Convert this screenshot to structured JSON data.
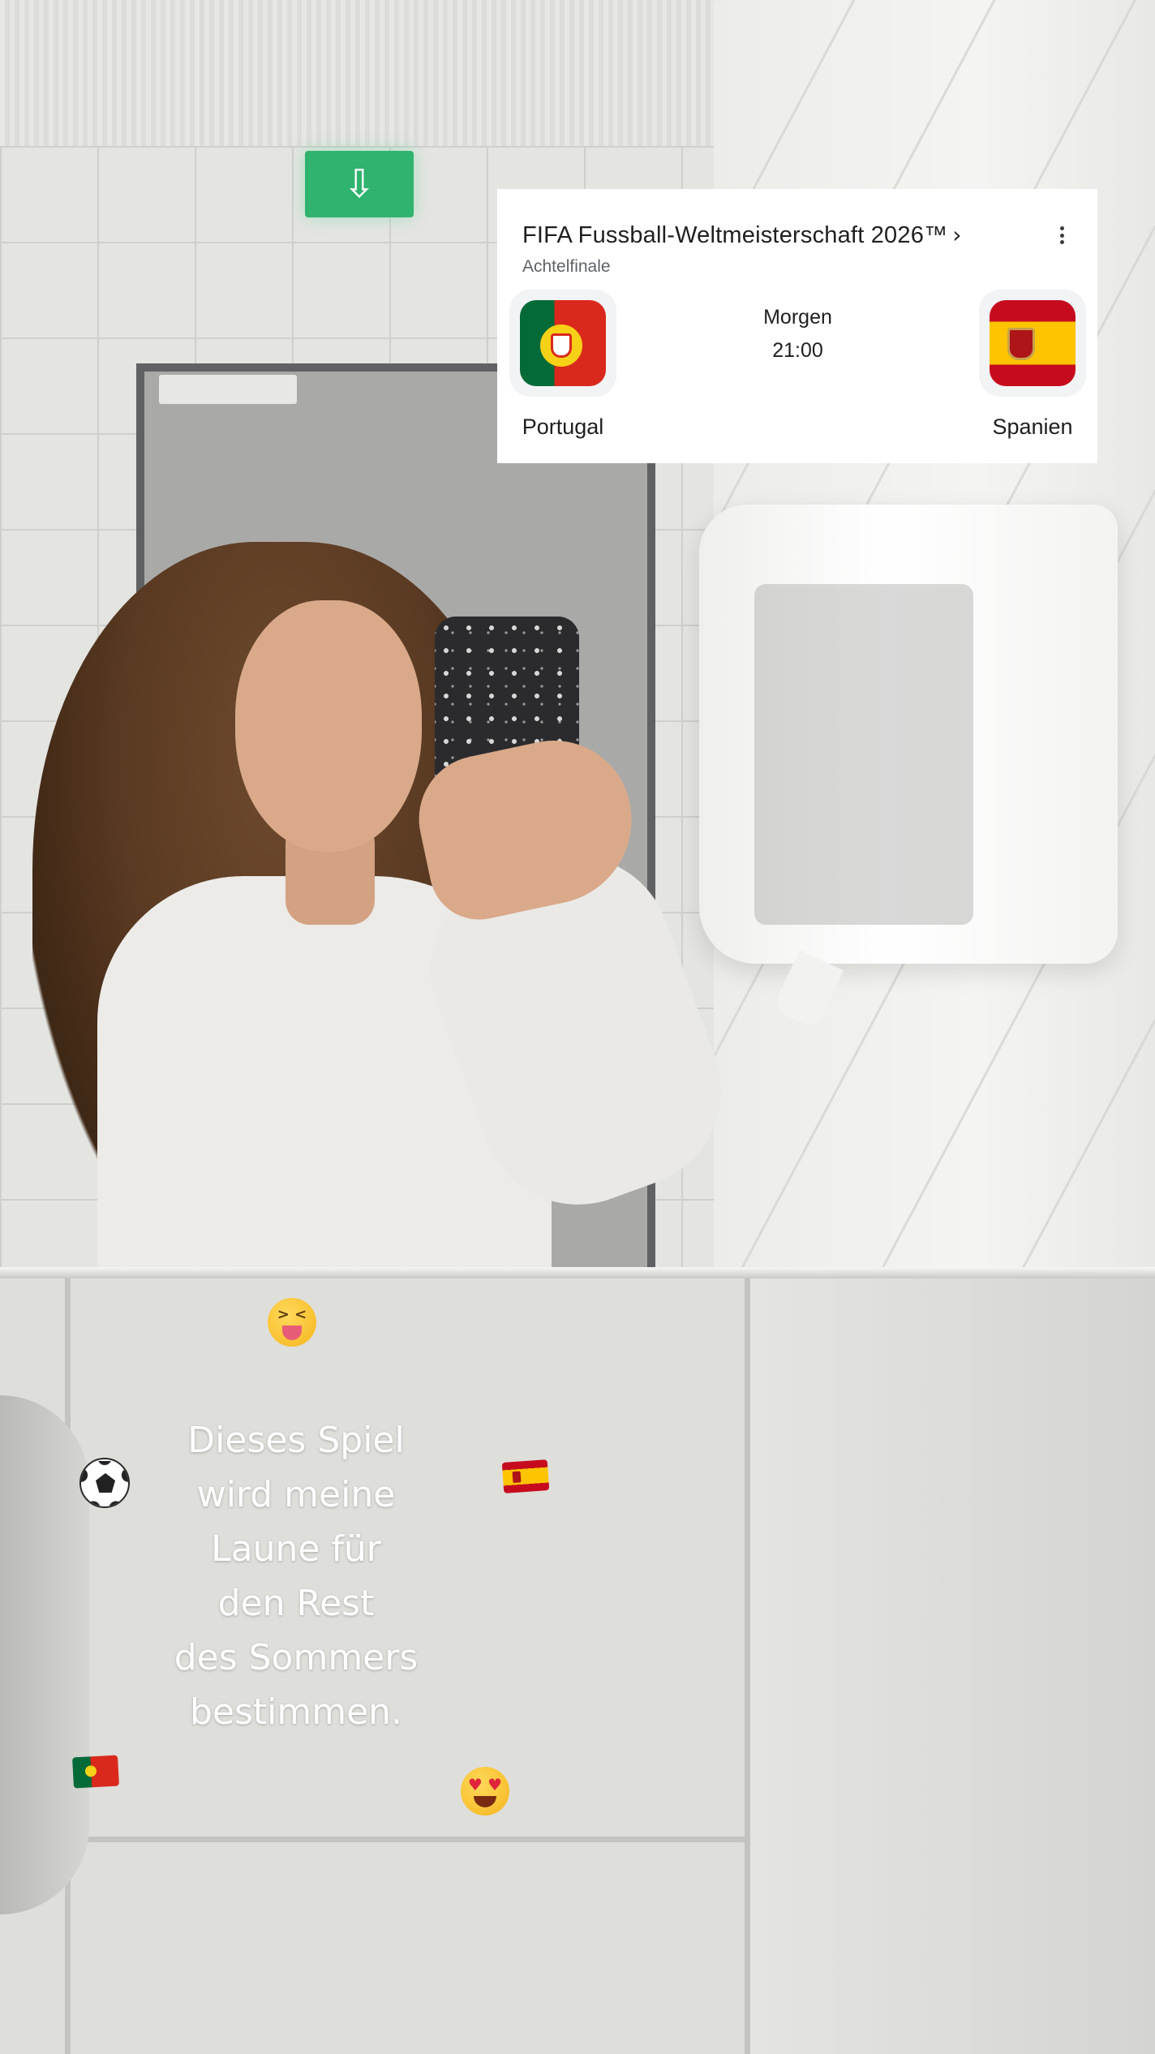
{
  "event_card": {
    "title": "FIFA Fussball-Weltmeisterschaft 2026™",
    "title_chevron": "›",
    "stage": "Achtelfinale",
    "match": {
      "day": "Morgen",
      "time": "21:00",
      "home_team": {
        "name": "Portugal",
        "flag_icon": "portugal-flag"
      },
      "away_team": {
        "name": "Spanien",
        "flag_icon": "spain-flag"
      }
    },
    "menu_icon": "more-vertical-icon"
  },
  "caption": {
    "lines": [
      "Dieses Spiel",
      "wird meine",
      "Laune für",
      "den Rest",
      "des Sommers",
      "bestimmen."
    ]
  },
  "stickers": [
    "squinting-tongue-emoji",
    "soccer-ball-emoji",
    "spain-flag-emoji",
    "portugal-flag-emoji",
    "heart-eyes-emoji"
  ],
  "colors": {
    "card_background": "#ffffff",
    "card_text": "#1f1f1f",
    "card_subtext": "#5f6368",
    "caption_text": "#ffffff",
    "exit_sign": "#2fb36f"
  }
}
